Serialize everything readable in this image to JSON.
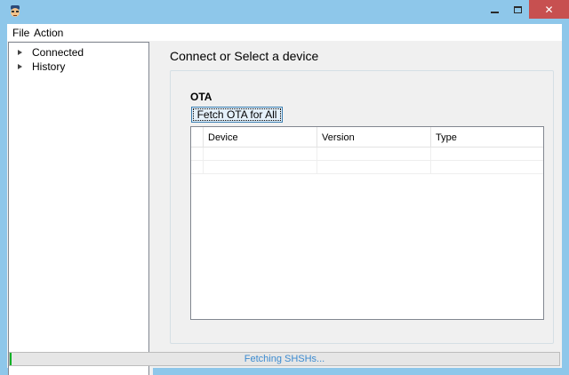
{
  "menu": {
    "file_label": "File",
    "action_label": "Action"
  },
  "tree": {
    "nodes": [
      {
        "label": "Connected"
      },
      {
        "label": "History"
      }
    ]
  },
  "panel": {
    "title": "Connect or Select a device",
    "ota_label": "OTA",
    "fetch_button_label": "Fetch OTA for All"
  },
  "grid": {
    "columns": [
      "Device",
      "Version",
      "Type"
    ],
    "rows": [
      [
        "",
        "",
        ""
      ],
      [
        "",
        "",
        ""
      ]
    ]
  },
  "status": {
    "text": "Fetching SHSHs...",
    "progress": 0.003
  },
  "icons": {
    "app": "app-icon",
    "minimize": "minimize-icon",
    "maximize": "maximize-icon",
    "close": "close-icon",
    "tree_expand": "triangle-right-icon"
  },
  "colors": {
    "titlebar": "#8ec7ea",
    "close_button": "#c75050",
    "status_text": "#3c8bd0",
    "button_focus": "#3c7fb1"
  }
}
